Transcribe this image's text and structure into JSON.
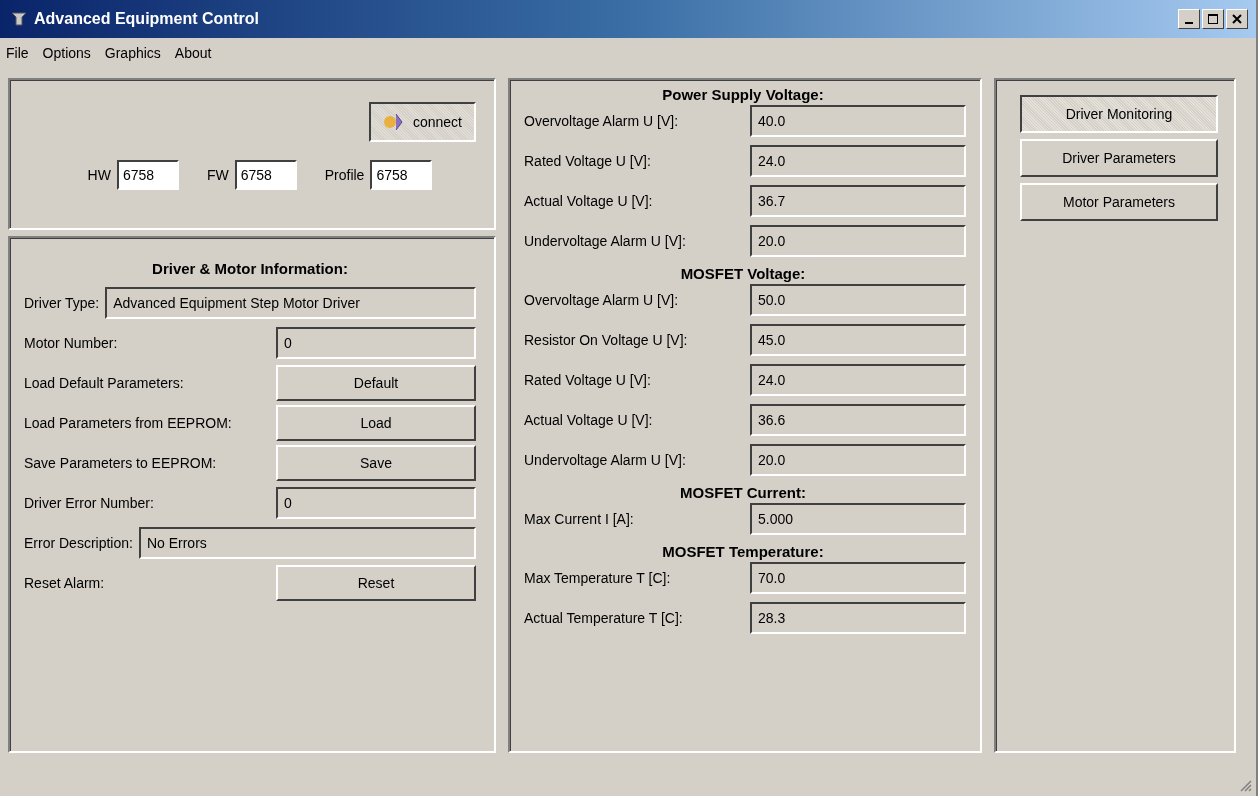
{
  "window": {
    "title": "Advanced Equipment Control"
  },
  "menu": [
    "File",
    "Options",
    "Graphics",
    "About"
  ],
  "connection": {
    "connect_button": "connect",
    "fields": [
      {
        "label": "HW",
        "value": "6758"
      },
      {
        "label": "FW",
        "value": "6758"
      },
      {
        "label": "Profile",
        "value": "6758"
      }
    ]
  },
  "driver_info": {
    "heading": "Driver & Motor Information:",
    "rows": [
      {
        "kind": "text_field",
        "label": "Driver Type:",
        "value": "Advanced Equipment Step Motor Driver"
      },
      {
        "kind": "number_field",
        "label": "Motor Number:",
        "value": "0"
      },
      {
        "kind": "button",
        "label": "Load Default Parameters:",
        "button": "Default"
      },
      {
        "kind": "button",
        "label": "Load Parameters from EEPROM:",
        "button": "Load"
      },
      {
        "kind": "button",
        "label": "Save Parameters to EEPROM:",
        "button": "Save"
      },
      {
        "kind": "number_field",
        "label": "Driver Error Number:",
        "value": "0"
      },
      {
        "kind": "text_field",
        "label": "Error Description:",
        "value": "No Errors"
      },
      {
        "kind": "button",
        "label": "Reset Alarm:",
        "button": "Reset"
      }
    ]
  },
  "monitoring": [
    {
      "heading": "Power Supply Voltage:",
      "rows": [
        {
          "label": "Overvoltage Alarm U [V]:",
          "value": "40.0"
        },
        {
          "label": "Rated Voltage U [V]:",
          "value": "24.0"
        },
        {
          "label": "Actual Voltage U [V]:",
          "value": "36.7"
        },
        {
          "label": "Undervoltage Alarm U [V]:",
          "value": "20.0"
        }
      ]
    },
    {
      "heading": "MOSFET Voltage:",
      "rows": [
        {
          "label": "Overvoltage Alarm U [V]:",
          "value": "50.0"
        },
        {
          "label": "Resistor On Voltage U [V]:",
          "value": "45.0"
        },
        {
          "label": "Rated Voltage U [V]:",
          "value": "24.0"
        },
        {
          "label": "Actual Voltage U [V]:",
          "value": "36.6"
        },
        {
          "label": "Undervoltage Alarm U [V]:",
          "value": "20.0"
        }
      ]
    },
    {
      "heading": "MOSFET Current:",
      "rows": [
        {
          "label": "Max Current I [A]:",
          "value": "5.000"
        }
      ]
    },
    {
      "heading": "MOSFET Temperature:",
      "rows": [
        {
          "label": "Max Temperature T [C]:",
          "value": "70.0"
        },
        {
          "label": "Actual Temperature T [C]:",
          "value": "28.3"
        }
      ]
    }
  ],
  "views": [
    {
      "label": "Driver Monitoring",
      "selected": true
    },
    {
      "label": "Driver Parameters",
      "selected": false
    },
    {
      "label": "Motor Parameters",
      "selected": false
    }
  ]
}
